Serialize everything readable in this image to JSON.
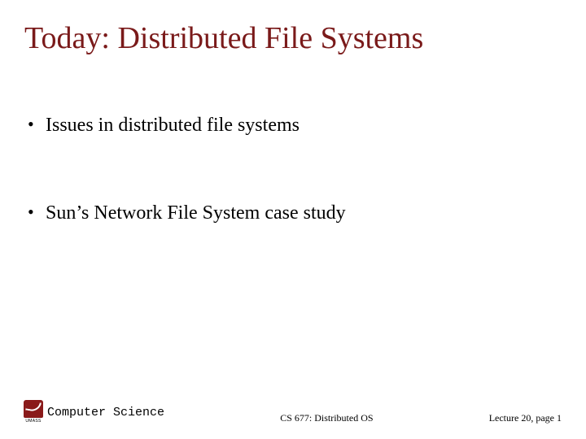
{
  "title": "Today: Distributed  File Systems",
  "bullets": [
    "Issues in distributed file systems",
    "Sun’s Network File System case study"
  ],
  "footer": {
    "logo_caption": "UMASS",
    "department": "Computer Science",
    "course": "CS 677: Distributed OS",
    "lecture": "Lecture 20, page 1"
  }
}
